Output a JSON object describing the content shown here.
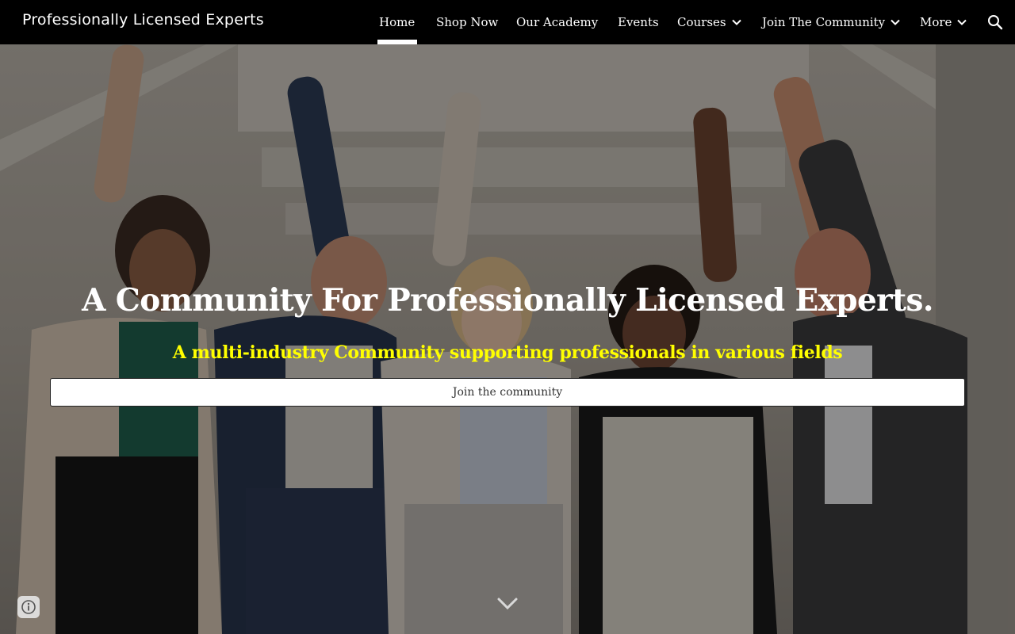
{
  "site": {
    "title": "Professionally Licensed Experts"
  },
  "nav": {
    "items": [
      {
        "label": "Home",
        "active": true,
        "dropdown": false
      },
      {
        "label": "Shop Now",
        "active": false,
        "dropdown": false
      },
      {
        "label": "Our Academy",
        "active": false,
        "dropdown": false
      },
      {
        "label": "Events",
        "active": false,
        "dropdown": false
      },
      {
        "label": "Courses",
        "active": false,
        "dropdown": true
      },
      {
        "label": "Join The Community",
        "active": false,
        "dropdown": true
      },
      {
        "label": "More",
        "active": false,
        "dropdown": true
      }
    ],
    "search_icon": "search-icon"
  },
  "hero": {
    "heading": "A Community For Professionally Licensed Experts.",
    "subheading": "A multi-industry Community supporting professionals in various fields",
    "cta_label": "Join the community",
    "scroll_icon": "chevron-down-icon",
    "info_icon": "info-icon",
    "image": "group of business professionals raising fists in celebration"
  },
  "colors": {
    "nav_background": "#000000",
    "nav_text": "#ffffff",
    "subheading": "#ffff00",
    "heading": "#ffffff"
  }
}
